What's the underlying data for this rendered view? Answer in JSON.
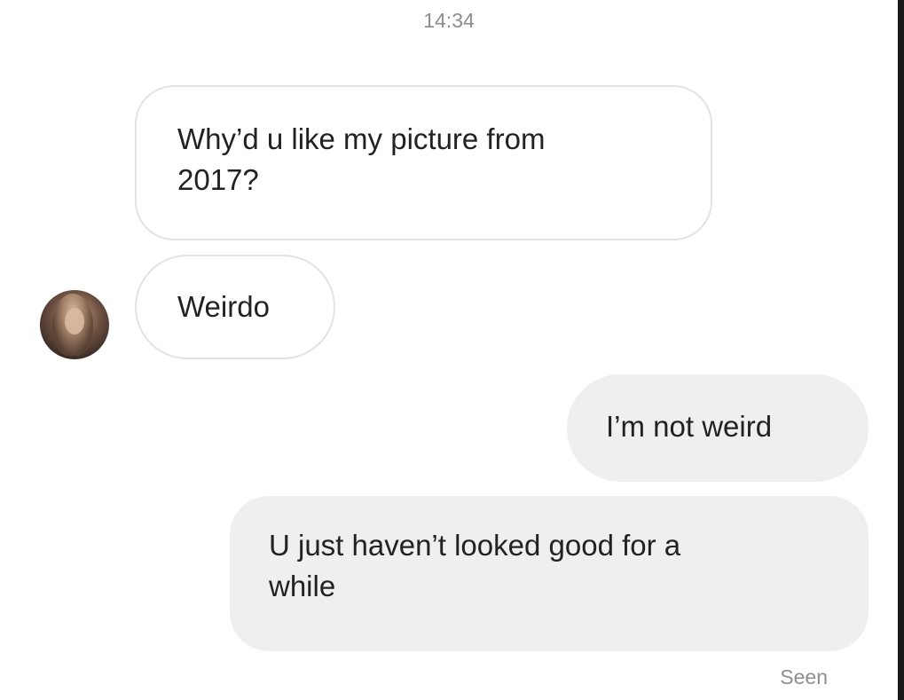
{
  "conversation": {
    "timestamp": "14:34",
    "messages": [
      {
        "direction": "received",
        "lines": [
          "Why’d u like my picture from",
          "2017?"
        ]
      },
      {
        "direction": "received",
        "lines": [
          "Weirdo"
        ]
      },
      {
        "direction": "sent",
        "lines": [
          "I’m not weird"
        ]
      },
      {
        "direction": "sent",
        "lines": [
          "U just haven’t looked good for a",
          "while"
        ]
      }
    ],
    "status": "Seen"
  },
  "icons": {
    "avatar": "profile-avatar-photo"
  },
  "colors": {
    "received_bubble_bg": "#ffffff",
    "received_bubble_border": "#e3e3e3",
    "sent_bubble_bg": "#efefef",
    "meta_text": "#8e8e8e",
    "message_text": "#222222"
  }
}
